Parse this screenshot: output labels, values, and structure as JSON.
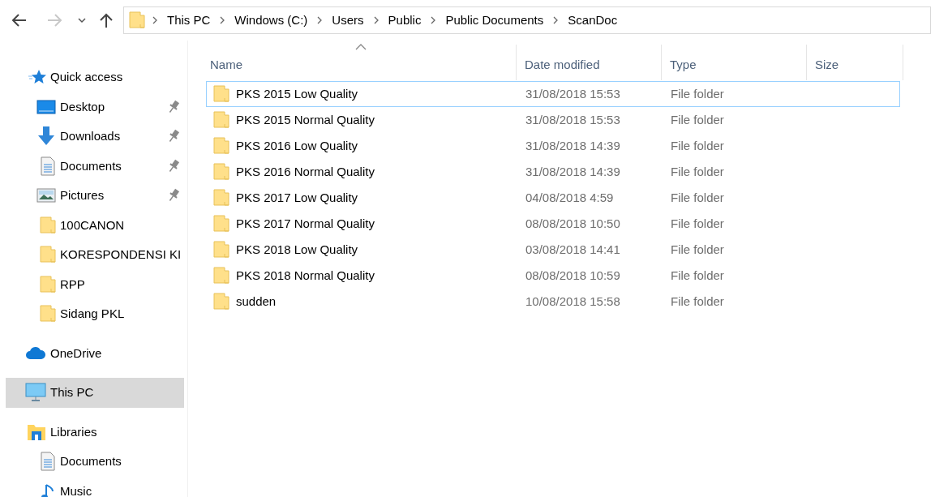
{
  "navigation": {
    "back": {
      "disabled": false
    },
    "forward": {
      "disabled": true
    },
    "up": {
      "disabled": false
    }
  },
  "address_bar": {
    "crumbs": [
      "This PC",
      "Windows (C:)",
      "Users",
      "Public",
      "Public Documents",
      "ScanDoc"
    ]
  },
  "sidebar": {
    "items": [
      {
        "label": "Quick access",
        "kind": "star",
        "selected": false,
        "children": [
          {
            "label": "Desktop",
            "kind": "desktop",
            "pinned": true,
            "selected": false
          },
          {
            "label": "Downloads",
            "kind": "download",
            "pinned": true,
            "selected": false
          },
          {
            "label": "Documents",
            "kind": "document",
            "pinned": true,
            "selected": false
          },
          {
            "label": "Pictures",
            "kind": "pictures",
            "pinned": true,
            "selected": false
          },
          {
            "label": "100CANON",
            "kind": "folder",
            "pinned": false,
            "selected": false
          },
          {
            "label": "KORESPONDENSI KI",
            "kind": "folder",
            "pinned": false,
            "selected": false
          },
          {
            "label": "RPP",
            "kind": "folder",
            "pinned": false,
            "selected": false
          },
          {
            "label": "Sidang PKL",
            "kind": "folder",
            "pinned": false,
            "selected": false
          }
        ]
      },
      {
        "label": "OneDrive",
        "kind": "cloud",
        "selected": false
      },
      {
        "label": "This PC",
        "kind": "computer",
        "selected": true
      },
      {
        "label": "Libraries",
        "kind": "libraries",
        "selected": false,
        "children": [
          {
            "label": "Documents",
            "kind": "document",
            "selected": false
          },
          {
            "label": "Music",
            "kind": "music",
            "selected": false
          }
        ]
      }
    ]
  },
  "file_list": {
    "columns": [
      {
        "label": "Name",
        "sorted": true
      },
      {
        "label": "Date modified",
        "sorted": false
      },
      {
        "label": "Type",
        "sorted": false
      },
      {
        "label": "Size",
        "sorted": false
      }
    ],
    "rows": [
      {
        "name": "PKS 2015 Low Quality",
        "date": "31/08/2018 15:53",
        "type": "File folder",
        "focused": true
      },
      {
        "name": "PKS 2015 Normal Quality",
        "date": "31/08/2018 15:53",
        "type": "File folder",
        "focused": false
      },
      {
        "name": "PKS 2016 Low Quality",
        "date": "31/08/2018 14:39",
        "type": "File folder",
        "focused": false
      },
      {
        "name": "PKS 2016 Normal Quality",
        "date": "31/08/2018 14:39",
        "type": "File folder",
        "focused": false
      },
      {
        "name": "PKS 2017 Low Quality",
        "date": "04/08/2018 4:59",
        "type": "File folder",
        "focused": false
      },
      {
        "name": "PKS 2017 Normal Quality",
        "date": "08/08/2018 10:50",
        "type": "File folder",
        "focused": false
      },
      {
        "name": "PKS 2018 Low Quality",
        "date": "03/08/2018 14:41",
        "type": "File folder",
        "focused": false
      },
      {
        "name": "PKS 2018 Normal Quality",
        "date": "08/08/2018 10:59",
        "type": "File folder",
        "focused": false
      },
      {
        "name": "sudden",
        "date": "10/08/2018 15:58",
        "type": "File folder",
        "focused": false
      }
    ]
  }
}
